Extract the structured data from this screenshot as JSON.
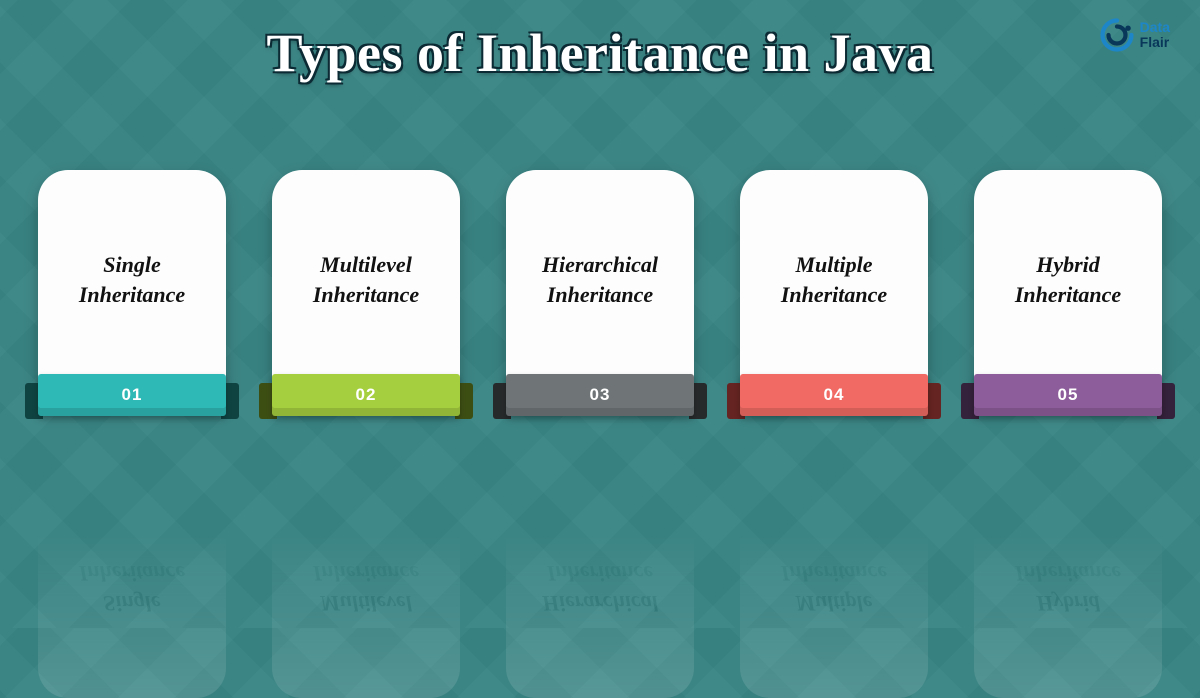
{
  "title": "Types of Inheritance in Java",
  "logo": {
    "line1": "Data",
    "line2": "Flair"
  },
  "cards": [
    {
      "label_line1": "Single",
      "label_line2": "Inheritance",
      "num": "01",
      "color": "#2fb9b6",
      "dark": "#1c7a78"
    },
    {
      "label_line1": "Multilevel",
      "label_line2": "Inheritance",
      "num": "02",
      "color": "#a6cf3f",
      "dark": "#6f8d23"
    },
    {
      "label_line1": "Hierarchical",
      "label_line2": "Inheritance",
      "num": "03",
      "color": "#6f7577",
      "dark": "#474c4e"
    },
    {
      "label_line1": "Multiple",
      "label_line2": "Inheritance",
      "num": "04",
      "color": "#f16a64",
      "dark": "#b8413c"
    },
    {
      "label_line1": "Hybrid",
      "label_line2": "Inheritance",
      "num": "05",
      "color": "#8d5d9b",
      "dark": "#5f3c6b"
    }
  ]
}
